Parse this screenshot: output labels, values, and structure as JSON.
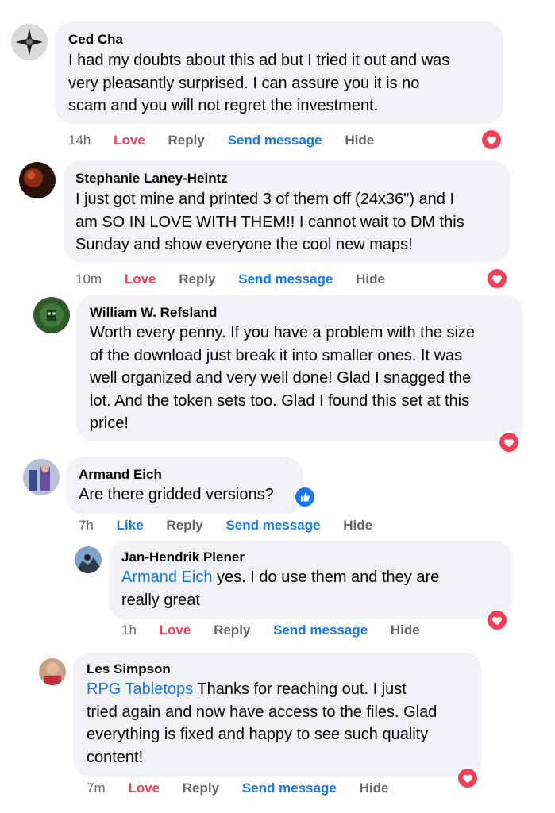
{
  "comments": [
    {
      "author": "Ced Cha",
      "text": [
        "I had my doubts about this ad but I tried it out and was",
        "very pleasantly surprised. I can assure you it is no",
        "scam and you will not regret the investment."
      ],
      "time": "14h",
      "reaction": "Love",
      "reply": "Reply",
      "send": "Send message",
      "hide": "Hide",
      "reaction_icon": "heart-icon"
    },
    {
      "author": "Stephanie Laney-Heintz",
      "text": [
        "I just got mine and printed 3 of them off (24x36\") and I",
        "am SO IN LOVE WITH THEM!! I cannot wait to DM this",
        "Sunday and show everyone the cool new maps!"
      ],
      "time": "10m",
      "reaction": "Love",
      "reply": "Reply",
      "send": "Send message",
      "hide": "Hide",
      "reaction_icon": "heart-icon"
    },
    {
      "author": "William W. Refsland",
      "text": [
        "Worth every penny. If you have a problem with the size",
        "of the download just break it into smaller ones. It was",
        "well organized and very well done! Glad I snagged the",
        "lot. And the token sets too. Glad I found this set at this",
        "price!"
      ],
      "reaction_icon": "heart-icon"
    },
    {
      "author": "Armand Eich",
      "text": [
        "Are there gridded versions?"
      ],
      "time": "7h",
      "reaction": "Like",
      "reply": "Reply",
      "send": "Send message",
      "hide": "Hide",
      "reaction_icon": "thumbs-up-icon"
    },
    {
      "author": "Jan-Hendrik Plener",
      "mention": "Armand Eich",
      "text_after_mention": " yes. I do use them and they are",
      "text": [
        "really great"
      ],
      "time": "1h",
      "reaction": "Love",
      "reply": "Reply",
      "send": "Send message",
      "hide": "Hide",
      "reaction_icon": "heart-icon"
    },
    {
      "author": "Les Simpson",
      "mention": "RPG Tabletops",
      "text_after_mention": " Thanks for reaching out. I just",
      "text": [
        "tried again and now have access to the files. Glad",
        "everything is fixed and happy to see such quality",
        "content!"
      ],
      "time": "7m",
      "reaction": "Love",
      "reply": "Reply",
      "send": "Send message",
      "hide": "Hide",
      "reaction_icon": "heart-icon"
    }
  ],
  "colors": {
    "bubble": "#f0f2f5",
    "love": "#f33e58",
    "link": "#1877f2",
    "muted": "#65676b"
  }
}
